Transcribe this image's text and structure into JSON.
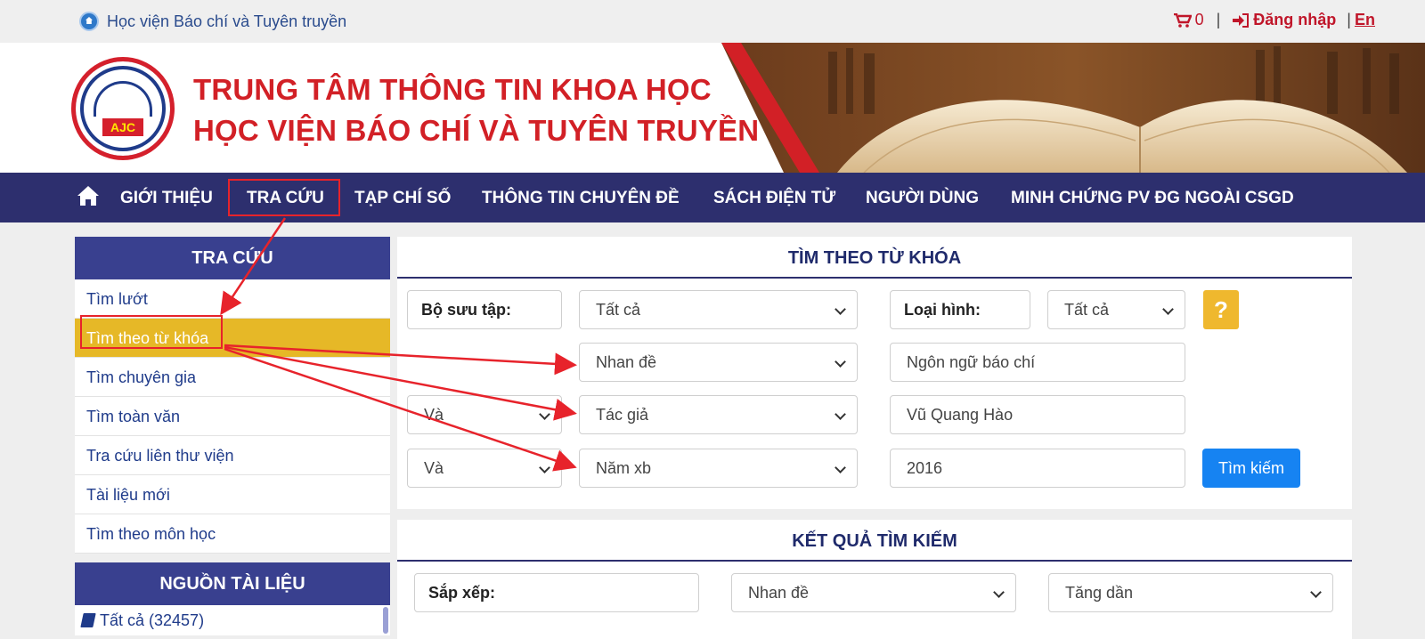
{
  "topbar": {
    "site_name": "Học viện Báo chí và Tuyên truyền",
    "cart_count": "0",
    "separator": "|",
    "login_label": "Đăng nhập",
    "lang_sep": "|",
    "lang_label": "En"
  },
  "header": {
    "logo_text": "AJC",
    "title_line1": "TRUNG TÂM THÔNG TIN KHOA HỌC",
    "title_line2": "HỌC VIỆN BÁO CHÍ VÀ TUYÊN TRUYỀN"
  },
  "nav": {
    "items": [
      "GIỚI THIỆU",
      "TRA CỨU",
      "TẠP CHÍ SỐ",
      "THÔNG TIN CHUYÊN ĐỀ",
      "SÁCH ĐIỆN TỬ",
      "NGƯỜI DÙNG",
      "MINH CHỨNG PV ĐG NGOÀI CSGD"
    ]
  },
  "sidebar": {
    "title": "TRA CỨU",
    "items": [
      "Tìm lướt",
      "Tìm theo từ khóa",
      "Tìm chuyên gia",
      "Tìm toàn văn",
      "Tra cứu liên thư viện",
      "Tài liệu mới",
      "Tìm theo môn học"
    ],
    "sources_title": "NGUỒN TÀI LIỆU",
    "sources": [
      "Tất cả (32457)"
    ]
  },
  "search": {
    "title": "TÌM THEO TỪ KHÓA",
    "collection_label": "Bộ sưu tập:",
    "collection_value": "Tất cả",
    "type_label": "Loại hình:",
    "type_value": "Tất cả",
    "help_label": "?",
    "rows": [
      {
        "op": "",
        "field": "Nhan đề",
        "value": "Ngôn ngữ báo chí"
      },
      {
        "op": "Và",
        "field": "Tác giả",
        "value": "Vũ Quang Hào"
      },
      {
        "op": "Và",
        "field": "Năm xb",
        "value": "2016"
      }
    ],
    "submit_label": "Tìm kiếm"
  },
  "results": {
    "title": "KẾT QUẢ TÌM KIẾM",
    "sort_label": "Sắp xếp:",
    "sort_field": "Nhan đề",
    "sort_order": "Tăng dần"
  },
  "colors": {
    "nav_bg": "#2d2f6e",
    "sidebar_head": "#39408f",
    "active_item": "#e6b827",
    "accent_red": "#d22026",
    "button_blue": "#1683f2",
    "annotation_red": "#e7232b"
  }
}
